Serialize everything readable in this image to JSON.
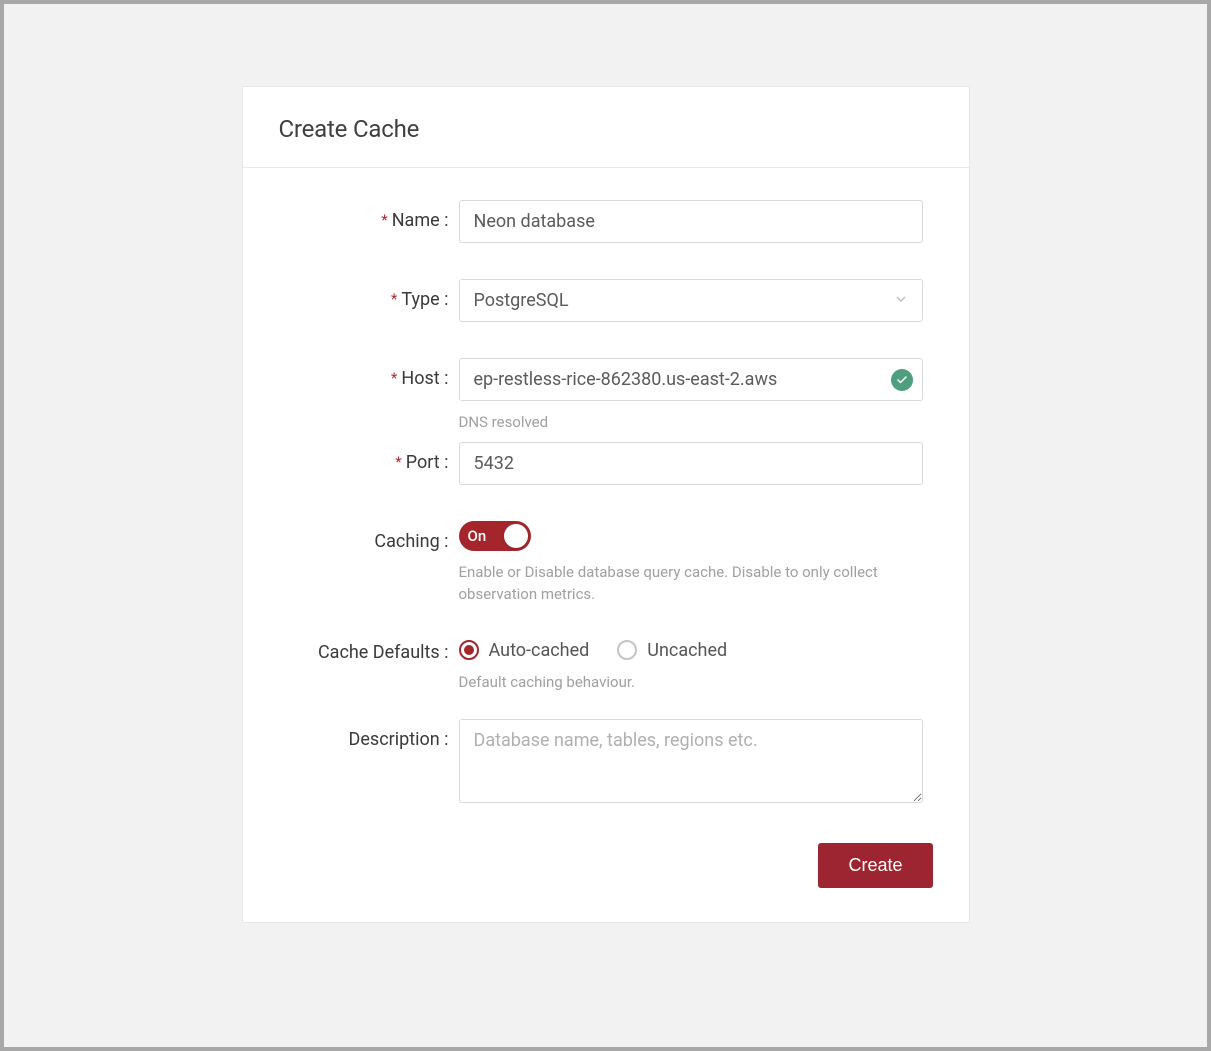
{
  "card": {
    "title": "Create Cache"
  },
  "form": {
    "name": {
      "label": "Name :",
      "value": "Neon database",
      "required": true
    },
    "type": {
      "label": "Type :",
      "value": "PostgreSQL",
      "required": true
    },
    "host": {
      "label": "Host :",
      "value": "ep-restless-rice-862380.us-east-2.aws",
      "required": true,
      "help": "DNS resolved",
      "status": "resolved"
    },
    "port": {
      "label": "Port :",
      "value": "5432",
      "required": true
    },
    "caching": {
      "label": "Caching :",
      "toggle_text": "On",
      "help": "Enable or Disable database query cache. Disable to only collect observation metrics."
    },
    "cache_defaults": {
      "label": "Cache Defaults :",
      "options": [
        {
          "label": "Auto-cached",
          "selected": true
        },
        {
          "label": "Uncached",
          "selected": false
        }
      ],
      "help": "Default caching behaviour."
    },
    "description": {
      "label": "Description :",
      "placeholder": "Database name, tables, regions etc.",
      "value": ""
    }
  },
  "buttons": {
    "create": "Create"
  }
}
